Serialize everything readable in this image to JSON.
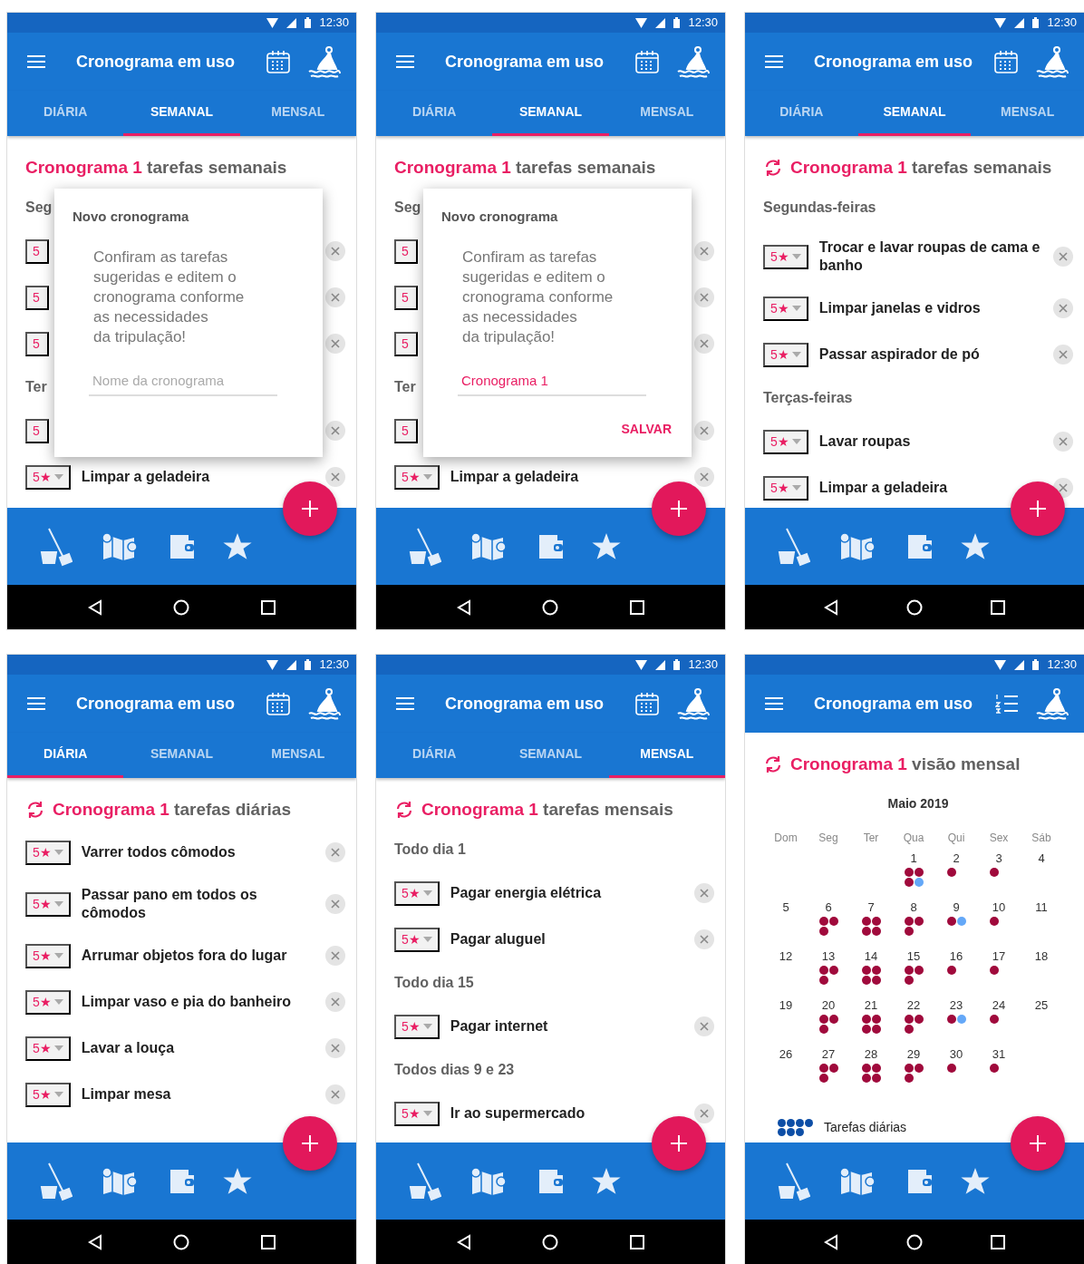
{
  "screens": [
    {
      "kind": "list",
      "time": "12:30",
      "title": "Cronograma em uso",
      "action": {
        "kind": "calendar"
      },
      "tabs": [
        {
          "label": "DIÁRIA",
          "selected": false
        },
        {
          "label": "SEMANAL",
          "selected": true
        },
        {
          "label": "MENSAL",
          "selected": false
        }
      ],
      "heading": {
        "name": "Cronograma 1",
        "rest": "tarefas semanais",
        "sync_icon": false
      },
      "sections": [
        {
          "title": "Seg",
          "tasks": [
            {
              "rating": "5",
              "covered": true
            },
            {
              "rating": "5",
              "covered": true
            },
            {
              "rating": "5",
              "covered": true
            }
          ]
        },
        {
          "title": "Ter",
          "tasks": [
            {
              "rating": "5",
              "covered": true
            },
            {
              "rating": "5★",
              "text": "Limpar a geladeira",
              "covered": false
            }
          ]
        }
      ],
      "dialog": {
        "title": "Novo cronograma",
        "message": "Confiram as tarefas\nsugeridas  e editem o\ncronograma conforme\nas necessidades\nda tripulação!",
        "field": {
          "placeholder": "Nome da cronograma"
        }
      }
    },
    {
      "kind": "list",
      "time": "12:30",
      "title": "Cronograma em uso",
      "action": {
        "kind": "calendar"
      },
      "tabs": [
        {
          "label": "DIÁRIA",
          "selected": false
        },
        {
          "label": "SEMANAL",
          "selected": true
        },
        {
          "label": "MENSAL",
          "selected": false
        }
      ],
      "heading": {
        "name": "Cronograma 1",
        "rest": "tarefas semanais",
        "sync_icon": false
      },
      "sections": [
        {
          "title": "Seg",
          "tasks": [
            {
              "rating": "5",
              "covered": true
            },
            {
              "rating": "5",
              "covered": true
            },
            {
              "rating": "5",
              "covered": true
            }
          ]
        },
        {
          "title": "Ter",
          "tasks": [
            {
              "rating": "5",
              "covered": true
            },
            {
              "rating": "5★",
              "text": "Limpar a geladeira",
              "covered": false
            }
          ]
        }
      ],
      "dialog": {
        "title": "Novo cronograma",
        "message": "Confiram as tarefas\nsugeridas  e editem o\ncronograma conforme\nas necessidades\nda tripulação!",
        "field": {
          "value": "Cronograma 1"
        },
        "button": "SALVAR"
      }
    },
    {
      "kind": "list",
      "time": "12:30",
      "title": "Cronograma em uso",
      "action": {
        "kind": "calendar"
      },
      "tabs": [
        {
          "label": "DIÁRIA",
          "selected": false
        },
        {
          "label": "SEMANAL",
          "selected": true
        },
        {
          "label": "MENSAL",
          "selected": false
        }
      ],
      "heading": {
        "name": "Cronograma 1",
        "rest": "tarefas semanais",
        "sync_icon": true
      },
      "sections": [
        {
          "title": "Segundas-feiras",
          "tasks": [
            {
              "rating": "5★",
              "text": "Trocar e lavar roupas de cama e banho",
              "covered": false
            },
            {
              "rating": "5★",
              "text": "Limpar janelas e vidros",
              "covered": false
            },
            {
              "rating": "5★",
              "text": "Passar aspirador de pó",
              "covered": false
            }
          ]
        },
        {
          "title": "Terças-feiras",
          "tasks": [
            {
              "rating": "5★",
              "text": "Lavar roupas",
              "covered": false
            },
            {
              "rating": "5★",
              "text": "Limpar a geladeira",
              "covered": false
            }
          ]
        }
      ]
    },
    {
      "kind": "list",
      "time": "12:30",
      "title": "Cronograma em uso",
      "action": {
        "kind": "calendar"
      },
      "tabs": [
        {
          "label": "DIÁRIA",
          "selected": true
        },
        {
          "label": "SEMANAL",
          "selected": false
        },
        {
          "label": "MENSAL",
          "selected": false
        }
      ],
      "heading": {
        "name": "Cronograma 1",
        "rest": "tarefas diárias",
        "sync_icon": true
      },
      "sections": [
        {
          "tasks": [
            {
              "rating": "5★",
              "text": "Varrer todos cômodos",
              "covered": false
            },
            {
              "rating": "5★",
              "text": "Passar pano em todos os cômodos",
              "covered": false
            },
            {
              "rating": "5★",
              "text": "Arrumar objetos fora do lugar",
              "covered": false
            },
            {
              "rating": "5★",
              "text": "Limpar vaso e pia do banheiro",
              "covered": false
            },
            {
              "rating": "5★",
              "text": "Lavar a louça",
              "covered": false
            },
            {
              "rating": "5★",
              "text": "Limpar mesa",
              "covered": false
            }
          ]
        }
      ]
    },
    {
      "kind": "list",
      "time": "12:30",
      "title": "Cronograma em uso",
      "action": {
        "kind": "calendar"
      },
      "tabs": [
        {
          "label": "DIÁRIA",
          "selected": false
        },
        {
          "label": "SEMANAL",
          "selected": false
        },
        {
          "label": "MENSAL",
          "selected": true
        }
      ],
      "heading": {
        "name": "Cronograma 1",
        "rest": "tarefas mensais",
        "sync_icon": true
      },
      "sections": [
        {
          "title": "Todo dia 1",
          "tasks": [
            {
              "rating": "5★",
              "text": "Pagar energia elétrica",
              "covered": false
            },
            {
              "rating": "5★",
              "text": "Pagar aluguel",
              "covered": false
            }
          ]
        },
        {
          "title": "Todo dia 15",
          "tasks": [
            {
              "rating": "5★",
              "text": "Pagar internet",
              "covered": false
            }
          ]
        },
        {
          "title": "Todos dias 9 e 23",
          "tasks": [
            {
              "rating": "5★",
              "text": "Ir ao supermercado",
              "covered": false
            }
          ]
        }
      ]
    },
    {
      "kind": "calendar",
      "time": "12:30",
      "title": "Cronograma em uso",
      "action": {
        "kind": "list"
      },
      "heading": {
        "name": "Cronograma 1",
        "rest": "visão mensal",
        "sync_icon": true
      },
      "calendar": {
        "month": "Maio 2019",
        "weekdays": [
          "Dom",
          "Seg",
          "Ter",
          "Qua",
          "Qui",
          "Sex",
          "Sáb"
        ],
        "weeks": [
          {
            "kind": "first",
            "days": [
              {
                "day": "1",
                "dots": [
                  {
                    "color": "#a00a3c"
                  },
                  {
                    "color": "#a00a3c"
                  },
                  {
                    "color": "#a00a3c"
                  },
                  {
                    "color": "#64a8f8"
                  }
                ]
              },
              {
                "day": "2",
                "dots": [
                  {
                    "color": "#a00a3c"
                  }
                ]
              },
              {
                "day": "3",
                "dots": [
                  {
                    "color": "#a00a3c"
                  }
                ]
              },
              {
                "day": "4"
              }
            ]
          },
          {
            "kind": "full",
            "days": [
              {
                "day": "5"
              },
              {
                "day": "6",
                "dots": [
                  {
                    "color": "#a00a3c"
                  },
                  {
                    "color": "#a00a3c"
                  },
                  {
                    "color": "#a00a3c"
                  }
                ]
              },
              {
                "day": "7",
                "dots": [
                  {
                    "color": "#a00a3c"
                  },
                  {
                    "color": "#a00a3c"
                  },
                  {
                    "color": "#a00a3c"
                  },
                  {
                    "color": "#a00a3c"
                  }
                ]
              },
              {
                "day": "8",
                "dots": [
                  {
                    "color": "#a00a3c"
                  },
                  {
                    "color": "#a00a3c"
                  },
                  {
                    "color": "#a00a3c"
                  }
                ]
              },
              {
                "day": "9",
                "dots": [
                  {
                    "color": "#a00a3c"
                  },
                  {
                    "color": "#64a8f8"
                  }
                ]
              },
              {
                "day": "10",
                "dots": [
                  {
                    "color": "#a00a3c"
                  }
                ]
              },
              {
                "day": "11"
              }
            ]
          },
          {
            "kind": "full",
            "days": [
              {
                "day": "12"
              },
              {
                "day": "13",
                "dots": [
                  {
                    "color": "#a00a3c"
                  },
                  {
                    "color": "#a00a3c"
                  },
                  {
                    "color": "#a00a3c"
                  }
                ]
              },
              {
                "day": "14",
                "dots": [
                  {
                    "color": "#a00a3c"
                  },
                  {
                    "color": "#a00a3c"
                  },
                  {
                    "color": "#a00a3c"
                  },
                  {
                    "color": "#a00a3c"
                  }
                ]
              },
              {
                "day": "15",
                "dots": [
                  {
                    "color": "#a00a3c"
                  },
                  {
                    "color": "#a00a3c"
                  },
                  {
                    "color": "#a00a3c"
                  }
                ]
              },
              {
                "day": "16",
                "dots": [
                  {
                    "color": "#a00a3c"
                  }
                ]
              },
              {
                "day": "17",
                "dots": [
                  {
                    "color": "#a00a3c"
                  }
                ]
              },
              {
                "day": "18"
              }
            ]
          },
          {
            "kind": "full",
            "days": [
              {
                "day": "19"
              },
              {
                "day": "20",
                "dots": [
                  {
                    "color": "#a00a3c"
                  },
                  {
                    "color": "#a00a3c"
                  },
                  {
                    "color": "#a00a3c"
                  }
                ]
              },
              {
                "day": "21",
                "dots": [
                  {
                    "color": "#a00a3c"
                  },
                  {
                    "color": "#a00a3c"
                  },
                  {
                    "color": "#a00a3c"
                  },
                  {
                    "color": "#a00a3c"
                  }
                ]
              },
              {
                "day": "22",
                "dots": [
                  {
                    "color": "#a00a3c"
                  },
                  {
                    "color": "#a00a3c"
                  },
                  {
                    "color": "#a00a3c"
                  }
                ]
              },
              {
                "day": "23",
                "dots": [
                  {
                    "color": "#a00a3c"
                  },
                  {
                    "color": "#64a8f8"
                  }
                ]
              },
              {
                "day": "24",
                "dots": [
                  {
                    "color": "#a00a3c"
                  }
                ]
              },
              {
                "day": "25"
              }
            ]
          },
          {
            "kind": "last",
            "days": [
              {
                "day": "26"
              },
              {
                "day": "27",
                "dots": [
                  {
                    "color": "#a00a3c"
                  },
                  {
                    "color": "#a00a3c"
                  },
                  {
                    "color": "#a00a3c"
                  }
                ]
              },
              {
                "day": "28",
                "dots": [
                  {
                    "color": "#a00a3c"
                  },
                  {
                    "color": "#a00a3c"
                  },
                  {
                    "color": "#a00a3c"
                  },
                  {
                    "color": "#a00a3c"
                  }
                ]
              },
              {
                "day": "29",
                "dots": [
                  {
                    "color": "#a00a3c"
                  },
                  {
                    "color": "#a00a3c"
                  },
                  {
                    "color": "#a00a3c"
                  }
                ]
              },
              {
                "day": "30",
                "dots": [
                  {
                    "color": "#a00a3c"
                  }
                ]
              },
              {
                "day": "31",
                "dots": [
                  {
                    "color": "#a00a3c"
                  }
                ]
              }
            ]
          }
        ],
        "legend": [
          {
            "label": "Tarefas diárias",
            "color": "#0d4ea6"
          }
        ]
      }
    }
  ]
}
